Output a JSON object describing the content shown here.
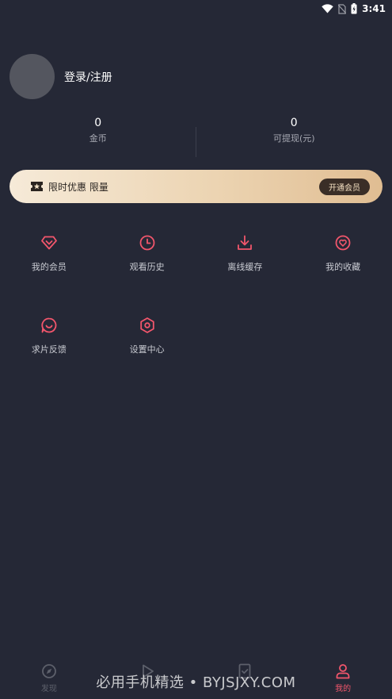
{
  "status_bar": {
    "time": "3:41"
  },
  "profile": {
    "login_label": "登录/注册"
  },
  "stats": [
    {
      "value": "0",
      "label": "金币"
    },
    {
      "value": "0",
      "label": "可提现(元)"
    }
  ],
  "vip_banner": {
    "text": "限时优惠 限量",
    "button_label": "开通会员"
  },
  "menu": [
    {
      "label": "我的会员",
      "icon": "diamond-icon"
    },
    {
      "label": "观看历史",
      "icon": "clock-icon"
    },
    {
      "label": "离线缓存",
      "icon": "download-icon"
    },
    {
      "label": "我的收藏",
      "icon": "heart-icon"
    },
    {
      "label": "求片反馈",
      "icon": "smile-chat-icon"
    },
    {
      "label": "设置中心",
      "icon": "settings-hexagon-icon"
    }
  ],
  "bottom_nav": [
    {
      "label": "发现",
      "icon": "compass-icon",
      "active": false
    },
    {
      "label": "",
      "icon": "play-icon",
      "active": false
    },
    {
      "label": "",
      "icon": "task-check-icon",
      "active": false
    },
    {
      "label": "我的",
      "icon": "user-icon",
      "active": true
    }
  ],
  "watermark": "必用手机精选 • BYJSJXY.COM",
  "colors": {
    "background": "#252836",
    "accent": "#f2566c",
    "vip_gold": "#e0bd92"
  }
}
